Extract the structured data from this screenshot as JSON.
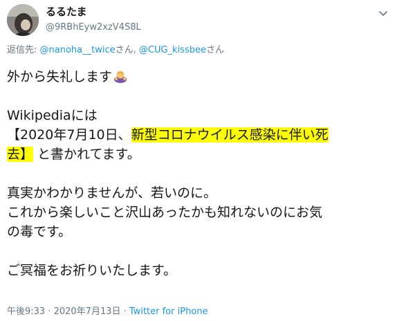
{
  "user": {
    "display_name": "るるたま",
    "handle": "@9RBhEyw2xzV4S8L"
  },
  "reply": {
    "prefix": "返信先: ",
    "mention1": "@nanoha__twice",
    "san1": "さん, ",
    "mention2": "@CUG_kissbee",
    "san2": "さん"
  },
  "body": {
    "line1": "外から失礼します",
    "emoji": "person-bowing-emoji",
    "line2": "Wikipediaには",
    "line3_pre": "【2020年7月10日、",
    "line3_hl": "新型コロナウイルス感染に伴い死",
    "line4_hl": "去】",
    "line4_post": " と書かれてます。",
    "line5": "真実かわかりませんが、若いのに。",
    "line6": "これから楽しいこと沢山あったかも知れないのにお気",
    "line7": "の毒です。",
    "line8": "ご冥福をお祈りいたします。"
  },
  "meta": {
    "timestamp": "午後9:33 · 2020年7月13日",
    "separator": " · ",
    "source": "Twitter for iPhone"
  },
  "colors": {
    "text": "#14171a",
    "muted": "#657786",
    "link": "#1b95e0",
    "highlight": "#ffff00"
  }
}
